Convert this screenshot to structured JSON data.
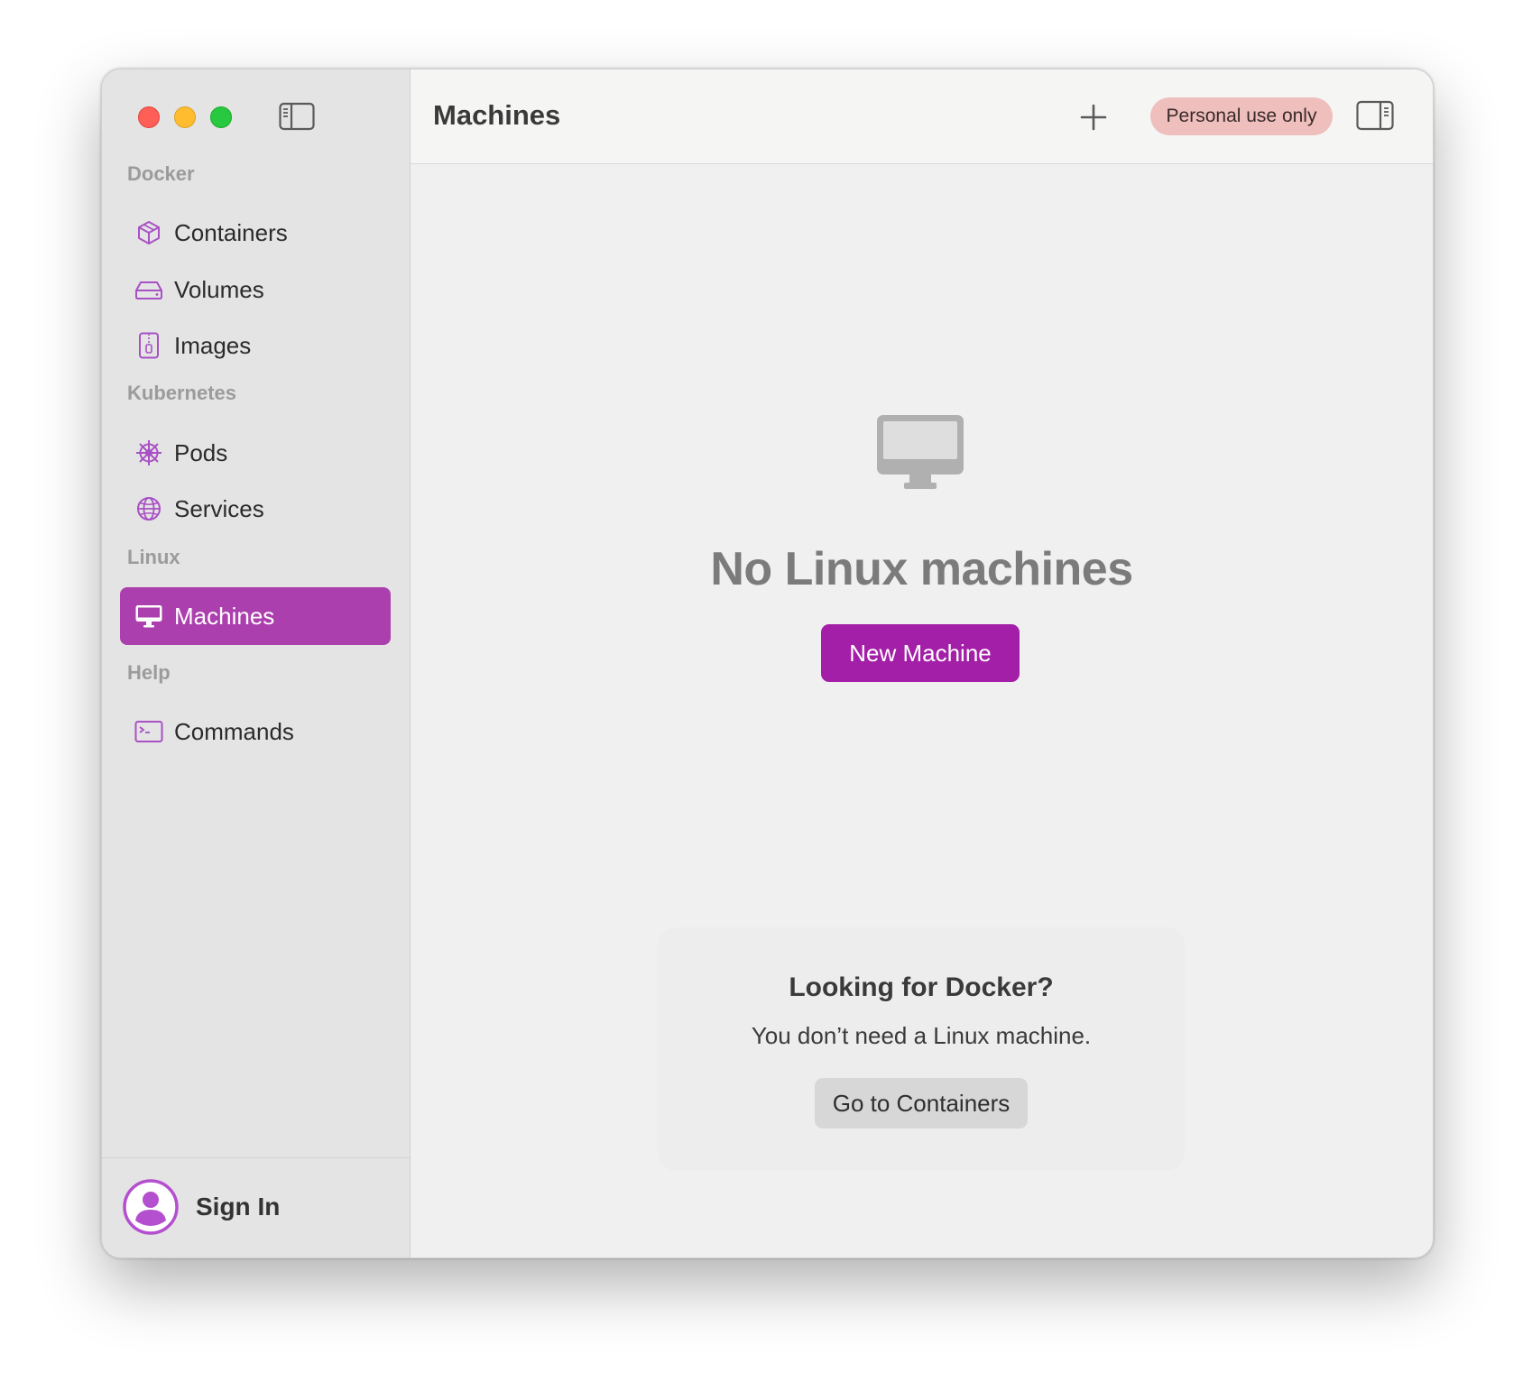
{
  "window": {
    "title": "Machines"
  },
  "sidebar": {
    "sections": {
      "docker": "Docker",
      "kubernetes": "Kubernetes",
      "linux": "Linux",
      "help": "Help"
    },
    "items": {
      "containers": "Containers",
      "volumes": "Volumes",
      "images": "Images",
      "pods": "Pods",
      "services": "Services",
      "machines": "Machines",
      "commands": "Commands"
    },
    "active_item": "Machines",
    "sign_in_label": "Sign In"
  },
  "toolbar": {
    "title": "Machines",
    "badge": "Personal use only",
    "add_icon": "plus-icon",
    "inspector_icon": "sidebar-right-icon"
  },
  "empty_state": {
    "icon": "desktop-computer-icon",
    "title": "No Linux machines",
    "button_label": "New Machine"
  },
  "hint": {
    "title": "Looking for Docker?",
    "text": "You don’t need a Linux machine.",
    "button_label": "Go to Containers"
  },
  "colors": {
    "accent": "#ac3fae",
    "primary_button": "#a41fa7",
    "icon_purple": "#a851c4",
    "badge_bg": "#eebfbd",
    "close": "#ff5f57",
    "minimize": "#febc2e",
    "maximize": "#28c840"
  }
}
